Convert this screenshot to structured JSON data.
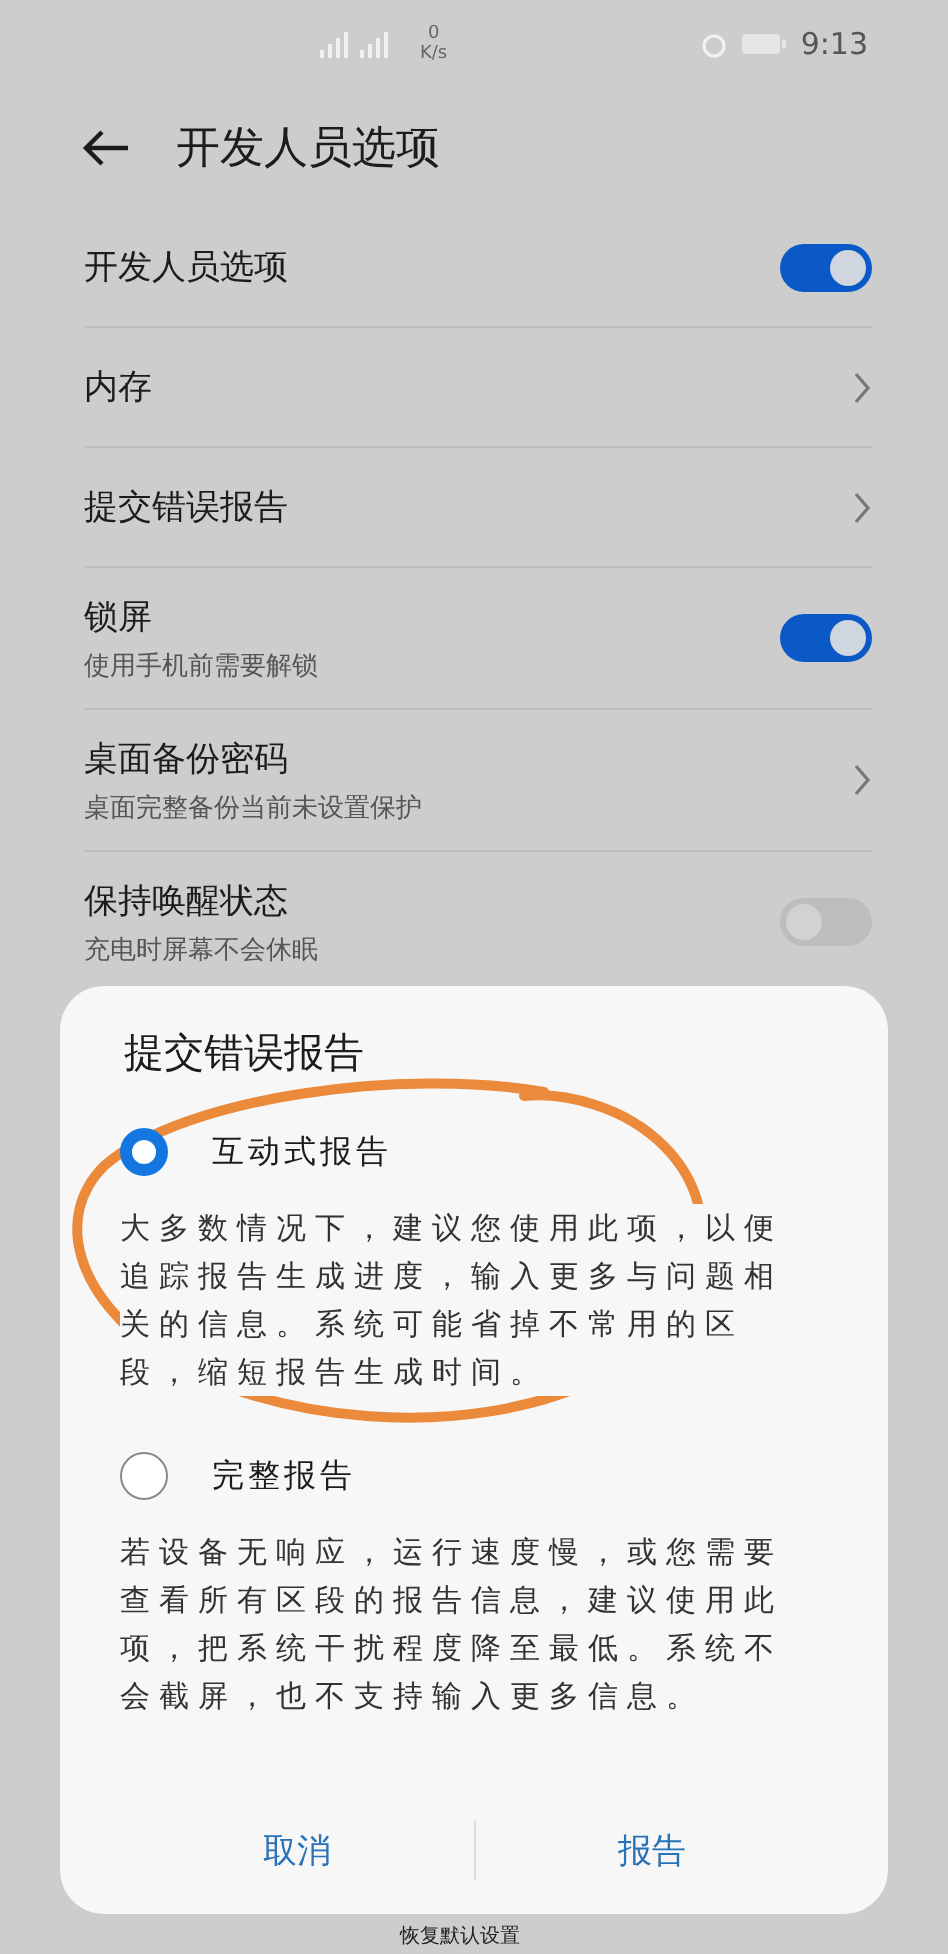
{
  "status_bar": {
    "speed_value": "0",
    "speed_unit": "K/s",
    "time": "9:13"
  },
  "header": {
    "title": "开发人员选项"
  },
  "settings": [
    {
      "kind": "toggle",
      "title": "开发人员选项",
      "on": true
    },
    {
      "kind": "link",
      "title": "内存"
    },
    {
      "kind": "link",
      "title": "提交错误报告"
    },
    {
      "kind": "toggle",
      "title": "锁屏",
      "subtitle": "使用手机前需要解锁",
      "on": true
    },
    {
      "kind": "link",
      "title": "桌面备份密码",
      "subtitle": "桌面完整备份当前未设置保护"
    },
    {
      "kind": "toggle",
      "title": "保持唤醒状态",
      "subtitle": "充电时屏幕不会休眠",
      "on": false
    }
  ],
  "footer_text": "恢复默认设置",
  "dialog": {
    "title": "提交错误报告",
    "options": [
      {
        "label": "互动式报告",
        "selected": true,
        "description": "大多数情况下，建议您使用此项，以便追踪报告生成进度，输入更多与问题相关的信息。系统可能省掉不常用的区段，缩短报告生成时间。"
      },
      {
        "label": "完整报告",
        "selected": false,
        "description": "若设备无响应，运行速度慢，或您需要查看所有区段的报告信息，建议使用此项，把系统干扰程度降至最低。系统不会截屏，也不支持输入更多信息。"
      }
    ],
    "buttons": [
      "取消",
      "报告"
    ]
  }
}
